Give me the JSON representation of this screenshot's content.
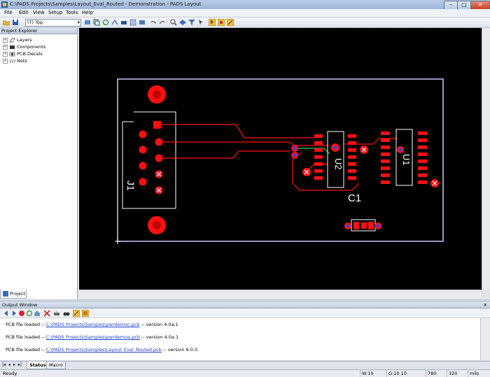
{
  "window": {
    "title": "C:\\PADS Projects\\Samples\\Layout_Eval_Routed - Demonstration - PADS Layout",
    "minimize_glyph": "–",
    "maximize_glyph": "□",
    "close_glyph": "✕"
  },
  "menu": [
    "File",
    "Edit",
    "View",
    "Setup",
    "Tools",
    "Help"
  ],
  "toolbar": {
    "layer_combo_value": "(T) Top",
    "combo_arrow": "▾"
  },
  "explorer": {
    "title": "Project Explorer",
    "items": [
      {
        "label": "Layers",
        "expander": "+"
      },
      {
        "label": "Components",
        "expander": "+"
      },
      {
        "label": "PCB Decals",
        "expander": "+"
      },
      {
        "label": "Nets",
        "expander": "+"
      }
    ],
    "tab_label": "Project"
  },
  "pcb": {
    "designator_u2": "U2",
    "designator_u1": "U1",
    "designator_c1": "C1",
    "designator_j1": "J1",
    "board_outline_color": "#c8c8ff",
    "copper_color": "#ff1010",
    "silk_color": "#ffffff"
  },
  "output": {
    "title": "Output Window",
    "close_glyph": "✕",
    "lines": [
      {
        "prefix": "PCB file loaded -- ",
        "link": "C:\\PADS Projects\\Samples\\pwrdemoc.pcb",
        "suffix": " -- version 4.0a.1"
      },
      {
        "prefix": "PCB file loaded -- ",
        "link": "C:\\PADS Projects\\Samples\\pwrdemoa.pcb",
        "suffix": " -- version 4.0a.1"
      },
      {
        "prefix": "PCB file loaded -- ",
        "link": "C:\\PADS Projects\\Samples\\Layout_Eval_Routed.pcb",
        "suffix": " -- version 9.0.0"
      }
    ],
    "tabs": [
      "Status",
      "Macro"
    ],
    "nav": [
      "|◂",
      "◂",
      "▸",
      "▸|"
    ]
  },
  "status": {
    "ready": "Ready",
    "width": "W:10",
    "grid": "G:10 10",
    "x": "780",
    "y": "320",
    "units": "mils"
  }
}
